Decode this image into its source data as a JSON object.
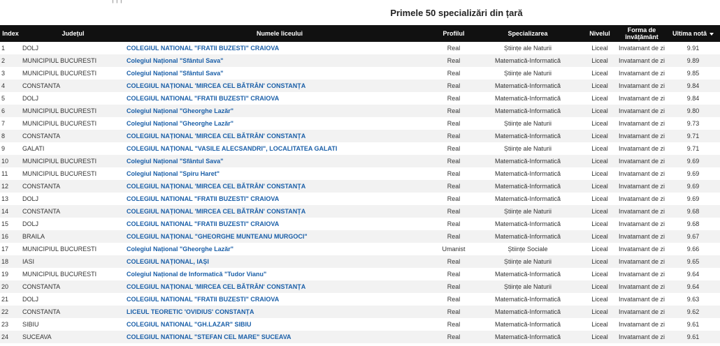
{
  "crumb": "|   |           |",
  "title": "Primele 50 specializări din țară",
  "columns": {
    "index": "Index",
    "judet": "Județul",
    "liceu": "Numele liceului",
    "profil": "Profilul",
    "specializare": "Specializarea",
    "nivel": "Nivelul",
    "forma": "Forma de învățământ",
    "nota": "Ultima notă"
  },
  "sort": {
    "column": "nota",
    "direction": "desc",
    "icon": "caret-down-icon"
  },
  "colors": {
    "header_bg": "#111111",
    "link": "#1a5fa8",
    "stripe": "#f2f2f2"
  },
  "rows": [
    {
      "index": "1",
      "judet": "DOLJ",
      "liceu": "COLEGIUL NATIONAL \"FRATII BUZESTI\" CRAIOVA",
      "profil": "Real",
      "spec": "Științe ale Naturii",
      "nivel": "Liceal",
      "forma": "Invatamant de zi",
      "nota": "9.91"
    },
    {
      "index": "2",
      "judet": "MUNICIPIUL BUCURESTI",
      "liceu": "Colegiul Național \"Sfântul Sava\"",
      "profil": "Real",
      "spec": "Matematică-Informatică",
      "nivel": "Liceal",
      "forma": "Invatamant de zi",
      "nota": "9.89"
    },
    {
      "index": "3",
      "judet": "MUNICIPIUL BUCURESTI",
      "liceu": "Colegiul Național \"Sfântul Sava\"",
      "profil": "Real",
      "spec": "Științe ale Naturii",
      "nivel": "Liceal",
      "forma": "Invatamant de zi",
      "nota": "9.85"
    },
    {
      "index": "4",
      "judet": "CONSTANTA",
      "liceu": "COLEGIUL NAȚIONAL 'MIRCEA CEL BĂTRÂN' CONSTANȚA",
      "profil": "Real",
      "spec": "Matematică-Informatică",
      "nivel": "Liceal",
      "forma": "Invatamant de zi",
      "nota": "9.84"
    },
    {
      "index": "5",
      "judet": "DOLJ",
      "liceu": "COLEGIUL NATIONAL \"FRATII BUZESTI\" CRAIOVA",
      "profil": "Real",
      "spec": "Matematică-Informatică",
      "nivel": "Liceal",
      "forma": "Invatamant de zi",
      "nota": "9.84"
    },
    {
      "index": "6",
      "judet": "MUNICIPIUL BUCURESTI",
      "liceu": "Colegiul Național \"Gheorghe Lazăr\"",
      "profil": "Real",
      "spec": "Matematică-Informatică",
      "nivel": "Liceal",
      "forma": "Invatamant de zi",
      "nota": "9.80"
    },
    {
      "index": "7",
      "judet": "MUNICIPIUL BUCURESTI",
      "liceu": "Colegiul Național \"Gheorghe Lazăr\"",
      "profil": "Real",
      "spec": "Științe ale Naturii",
      "nivel": "Liceal",
      "forma": "Invatamant de zi",
      "nota": "9.73"
    },
    {
      "index": "8",
      "judet": "CONSTANTA",
      "liceu": "COLEGIUL NAȚIONAL 'MIRCEA CEL BĂTRÂN' CONSTANȚA",
      "profil": "Real",
      "spec": "Matematică-Informatică",
      "nivel": "Liceal",
      "forma": "Invatamant de zi",
      "nota": "9.71"
    },
    {
      "index": "9",
      "judet": "GALATI",
      "liceu": "COLEGIUL NAȚIONAL \"VASILE ALECSANDRI\", LOCALITATEA GALATI",
      "profil": "Real",
      "spec": "Științe ale Naturii",
      "nivel": "Liceal",
      "forma": "Invatamant de zi",
      "nota": "9.71"
    },
    {
      "index": "10",
      "judet": "MUNICIPIUL BUCURESTI",
      "liceu": "Colegiul Național \"Sfântul Sava\"",
      "profil": "Real",
      "spec": "Matematică-Informatică",
      "nivel": "Liceal",
      "forma": "Invatamant de zi",
      "nota": "9.69"
    },
    {
      "index": "11",
      "judet": "MUNICIPIUL BUCURESTI",
      "liceu": "Colegiul Național \"Spiru Haret\"",
      "profil": "Real",
      "spec": "Matematică-Informatică",
      "nivel": "Liceal",
      "forma": "Invatamant de zi",
      "nota": "9.69"
    },
    {
      "index": "12",
      "judet": "CONSTANTA",
      "liceu": "COLEGIUL NAȚIONAL 'MIRCEA CEL BĂTRÂN' CONSTANȚA",
      "profil": "Real",
      "spec": "Matematică-Informatică",
      "nivel": "Liceal",
      "forma": "Invatamant de zi",
      "nota": "9.69"
    },
    {
      "index": "13",
      "judet": "DOLJ",
      "liceu": "COLEGIUL NATIONAL \"FRATII BUZESTI\" CRAIOVA",
      "profil": "Real",
      "spec": "Matematică-Informatică",
      "nivel": "Liceal",
      "forma": "Invatamant de zi",
      "nota": "9.69"
    },
    {
      "index": "14",
      "judet": "CONSTANTA",
      "liceu": "COLEGIUL NAȚIONAL 'MIRCEA CEL BĂTRÂN' CONSTANȚA",
      "profil": "Real",
      "spec": "Științe ale Naturii",
      "nivel": "Liceal",
      "forma": "Invatamant de zi",
      "nota": "9.68"
    },
    {
      "index": "15",
      "judet": "DOLJ",
      "liceu": "COLEGIUL NATIONAL \"FRATII BUZESTI\" CRAIOVA",
      "profil": "Real",
      "spec": "Matematică-Informatică",
      "nivel": "Liceal",
      "forma": "Invatamant de zi",
      "nota": "9.68"
    },
    {
      "index": "16",
      "judet": "BRAILA",
      "liceu": "COLEGIUL NAȚIONAL \"GHEORGHE MUNTEANU MURGOCI\"",
      "profil": "Real",
      "spec": "Matematică-Informatică",
      "nivel": "Liceal",
      "forma": "Invatamant de zi",
      "nota": "9.67"
    },
    {
      "index": "17",
      "judet": "MUNICIPIUL BUCURESTI",
      "liceu": "Colegiul Național \"Gheorghe Lazăr\"",
      "profil": "Umanist",
      "spec": "Științe Sociale",
      "nivel": "Liceal",
      "forma": "Invatamant de zi",
      "nota": "9.66"
    },
    {
      "index": "18",
      "judet": "IASI",
      "liceu": "COLEGIUL NAȚIONAL, IAȘI",
      "profil": "Real",
      "spec": "Științe ale Naturii",
      "nivel": "Liceal",
      "forma": "Invatamant de zi",
      "nota": "9.65"
    },
    {
      "index": "19",
      "judet": "MUNICIPIUL BUCURESTI",
      "liceu": "Colegiul Național de Informatică \"Tudor Vianu\"",
      "profil": "Real",
      "spec": "Matematică-Informatică",
      "nivel": "Liceal",
      "forma": "Invatamant de zi",
      "nota": "9.64"
    },
    {
      "index": "20",
      "judet": "CONSTANTA",
      "liceu": "COLEGIUL NAȚIONAL 'MIRCEA CEL BĂTRÂN' CONSTANȚA",
      "profil": "Real",
      "spec": "Științe ale Naturii",
      "nivel": "Liceal",
      "forma": "Invatamant de zi",
      "nota": "9.64"
    },
    {
      "index": "21",
      "judet": "DOLJ",
      "liceu": "COLEGIUL NATIONAL \"FRATII BUZESTI\" CRAIOVA",
      "profil": "Real",
      "spec": "Matematică-Informatică",
      "nivel": "Liceal",
      "forma": "Invatamant de zi",
      "nota": "9.63"
    },
    {
      "index": "22",
      "judet": "CONSTANTA",
      "liceu": "LICEUL TEORETIC 'OVIDIUS' CONSTANȚA",
      "profil": "Real",
      "spec": "Matematică-Informatică",
      "nivel": "Liceal",
      "forma": "Invatamant de zi",
      "nota": "9.62"
    },
    {
      "index": "23",
      "judet": "SIBIU",
      "liceu": "COLEGIUL NATIONAL \"GH.LAZAR\" SIBIU",
      "profil": "Real",
      "spec": "Matematică-Informatică",
      "nivel": "Liceal",
      "forma": "Invatamant de zi",
      "nota": "9.61"
    },
    {
      "index": "24",
      "judet": "SUCEAVA",
      "liceu": "COLEGIUL NATIONAL \"STEFAN CEL MARE\" SUCEAVA",
      "profil": "Real",
      "spec": "Matematică-Informatică",
      "nivel": "Liceal",
      "forma": "Invatamant de zi",
      "nota": "9.61"
    }
  ]
}
